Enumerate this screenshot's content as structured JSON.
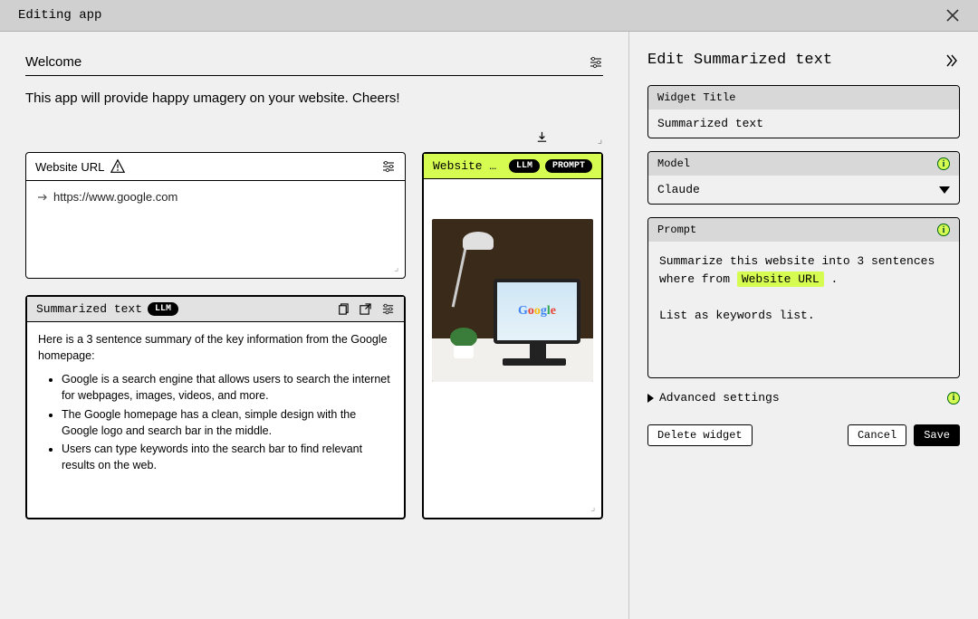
{
  "topbar": {
    "title": "Editing app"
  },
  "welcome": {
    "label": "Welcome",
    "description": "This app will provide happy umagery on your website. Cheers!"
  },
  "url_widget": {
    "title": "Website URL",
    "value": "https://www.google.com"
  },
  "image_widget": {
    "title": "Website Im…",
    "badges": [
      "LLM",
      "PROMPT"
    ]
  },
  "summary_widget": {
    "title": "Summarized text",
    "badge": "LLM",
    "intro": "Here is a 3 sentence summary of the key information from the Google homepage:",
    "bullets": [
      "Google is a search engine that allows users to search the internet for webpages, images, videos, and more.",
      "The Google homepage has a clean, simple design with the Google logo and search bar in the middle.",
      "Users can type keywords into the search bar to find relevant results on the web."
    ]
  },
  "panel": {
    "title": "Edit Summarized text",
    "widget_title_label": "Widget Title",
    "widget_title_value": "Summarized text",
    "model_label": "Model",
    "model_value": "Claude",
    "prompt_label": "Prompt",
    "prompt_pre": "Summarize this website into 3 sentences where from",
    "prompt_chip": "Website URL",
    "prompt_post": ".",
    "prompt_line2": "List as keywords list.",
    "advanced_label": "Advanced settings",
    "delete_btn": "Delete widget",
    "cancel_btn": "Cancel",
    "save_btn": "Save"
  }
}
